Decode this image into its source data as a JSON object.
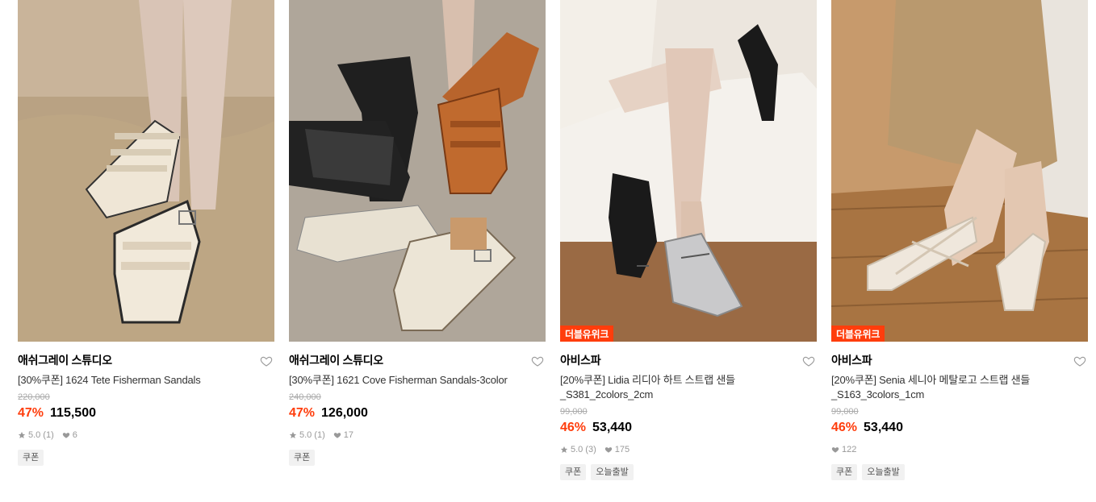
{
  "products": [
    {
      "brand": "애쉬그레이 스튜디오",
      "title": "[30%쿠폰] 1624 Tete Fisherman Sandals",
      "original_price": "220,000",
      "discount": "47%",
      "price": "115,500",
      "rating": "5.0",
      "review_count": "(1)",
      "likes": "6",
      "tags": [
        "쿠폰"
      ],
      "badge": "",
      "image_icon": "product-photo-ivory-fisherman-sandals"
    },
    {
      "brand": "애쉬그레이 스튜디오",
      "title": "[30%쿠폰] 1621 Cove Fisherman Sandals-3color",
      "original_price": "240,000",
      "discount": "47%",
      "price": "126,000",
      "rating": "5.0",
      "review_count": "(1)",
      "likes": "17",
      "tags": [
        "쿠폰"
      ],
      "badge": "",
      "image_icon": "product-photo-three-color-fisherman-sandals"
    },
    {
      "brand": "아비스파",
      "title_line1": "[20%쿠폰] Lidia 리디아 하트 스트랩 샌들",
      "title_line2": "_S381_2colors_2cm",
      "original_price": "99,000",
      "discount": "46%",
      "price": "53,440",
      "rating": "5.0",
      "review_count": "(3)",
      "likes": "175",
      "tags": [
        "쿠폰",
        "오늘출발"
      ],
      "badge": "더블유위크",
      "image_icon": "product-photo-heart-strap-sandals"
    },
    {
      "brand": "아비스파",
      "title_line1": "[20%쿠폰] Senia 세니아 메탈로고 스트랩 샌들",
      "title_line2": "_S163_3colors_1cm",
      "original_price": "99,000",
      "discount": "46%",
      "price": "53,440",
      "likes": "122",
      "tags": [
        "쿠폰",
        "오늘출발"
      ],
      "badge": "더블유위크",
      "image_icon": "product-photo-metal-logo-strap-sandals"
    }
  ],
  "colors": {
    "accent": "#ff3d0c",
    "muted": "#999999",
    "tag_bg": "#f1f1f1"
  }
}
